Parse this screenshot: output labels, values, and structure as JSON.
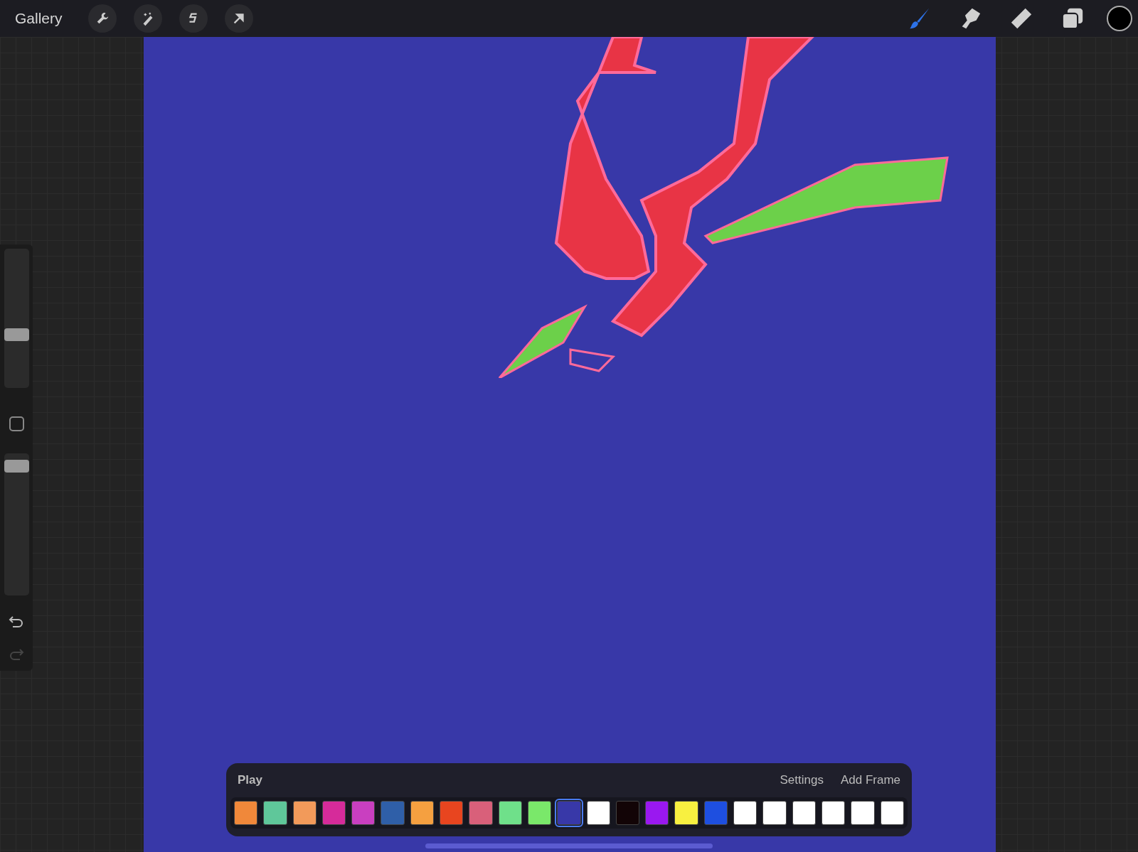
{
  "top_bar": {
    "gallery_label": "Gallery",
    "left_tools": [
      {
        "kind": "wrench"
      },
      {
        "kind": "wand"
      },
      {
        "kind": "selection"
      },
      {
        "kind": "move"
      }
    ],
    "right_tools": [
      {
        "kind": "brush",
        "selected": true
      },
      {
        "kind": "smudge",
        "selected": false
      },
      {
        "kind": "eraser",
        "selected": false
      },
      {
        "kind": "layers",
        "selected": false
      }
    ]
  },
  "sidebar": {
    "brush_size": {
      "level": 0.37
    },
    "opacity": {
      "level": 0.95
    }
  },
  "timeline": {
    "play_label": "Play",
    "settings_label": "Settings",
    "add_frame_label": "Add Frame",
    "frames": [
      {
        "color": "#f0883a",
        "selected": false
      },
      {
        "color": "#5fc79a",
        "selected": false
      },
      {
        "color": "#f29a5a",
        "selected": false
      },
      {
        "color": "#d62b9a",
        "selected": false
      },
      {
        "color": "#c93fc0",
        "selected": false
      },
      {
        "color": "#2f5fa8",
        "selected": false
      },
      {
        "color": "#f5a040",
        "selected": false
      },
      {
        "color": "#e8451f",
        "selected": false
      },
      {
        "color": "#d9607a",
        "selected": false
      },
      {
        "color": "#6fe08a",
        "selected": false
      },
      {
        "color": "#7ae86a",
        "selected": false
      },
      {
        "color": "#3838a8",
        "selected": true
      },
      {
        "color": "#ffffff",
        "selected": false
      },
      {
        "color": "#120406",
        "selected": false
      },
      {
        "color": "#9a18f0",
        "selected": false
      },
      {
        "color": "#f8f040",
        "selected": false
      },
      {
        "color": "#1e4fe0",
        "selected": false
      },
      {
        "color": "#ffffff",
        "selected": false
      },
      {
        "color": "#ffffff",
        "selected": false
      },
      {
        "color": "#ffffff",
        "selected": false
      },
      {
        "color": "#ffffff",
        "selected": false
      },
      {
        "color": "#ffffff",
        "selected": false
      },
      {
        "color": "#ffffff",
        "selected": false
      }
    ]
  }
}
